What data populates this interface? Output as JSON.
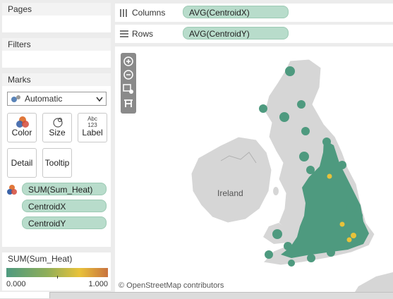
{
  "cards": {
    "pages_title": "Pages",
    "filters_title": "Filters",
    "marks_title": "Marks"
  },
  "marks": {
    "type_value": "Automatic",
    "buttons": {
      "color": "Color",
      "size": "Size",
      "label": "Label",
      "label_icon_top": "Abc",
      "label_icon_bottom": "123",
      "detail": "Detail",
      "tooltip": "Tooltip"
    },
    "fields": [
      "SUM(Sum_Heat)",
      "CentroidX",
      "CentroidY"
    ]
  },
  "shelves": {
    "columns_label": "Columns",
    "columns_pill": "AVG(CentroidX)",
    "rows_label": "Rows",
    "rows_pill": "AVG(CentroidY)"
  },
  "legend": {
    "title": "SUM(Sum_Heat)",
    "min": "0.000",
    "max": "1.000",
    "colors": [
      "#4e9a7f",
      "#8fae5a",
      "#e8c23a",
      "#c9733f"
    ]
  },
  "map": {
    "place_label": "Ireland",
    "attribution": "© OpenStreetMap contributors",
    "land_color": "#d6d6d6",
    "point_color": "#4e9a7f",
    "hot_color": "#e8c23a",
    "controls": [
      "zoom-in",
      "zoom-out",
      "rectangle-select",
      "pin"
    ]
  }
}
